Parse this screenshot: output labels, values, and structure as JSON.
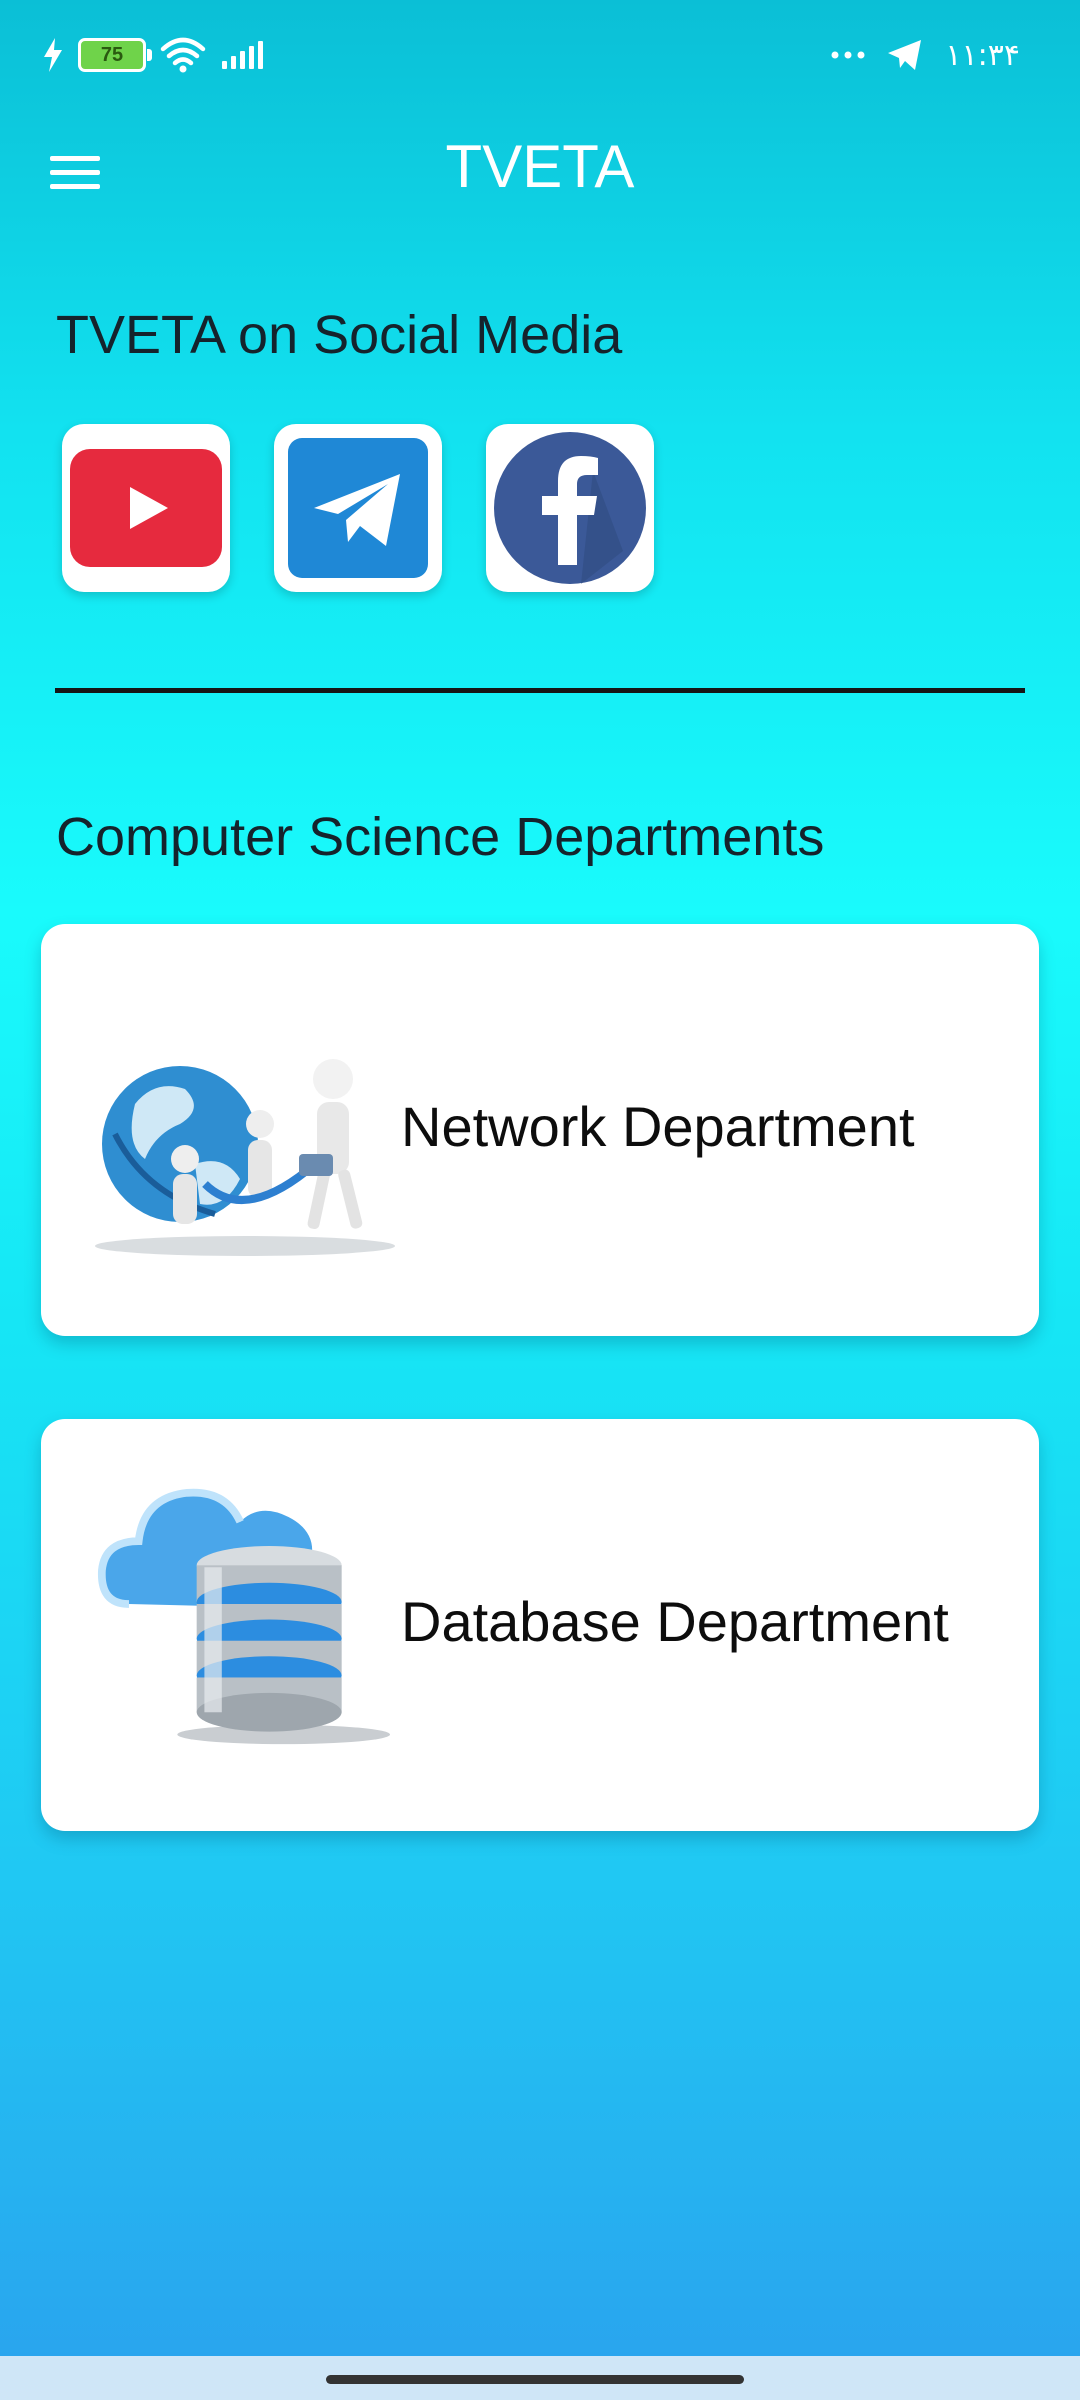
{
  "status_bar": {
    "battery_level": "75",
    "time": "١١:٣۴",
    "icons": [
      "charging-bolt-icon",
      "battery-icon",
      "wifi-icon",
      "signal-bars-icon",
      "more-dots-icon",
      "telegram-notification-icon"
    ]
  },
  "app_bar": {
    "title": "TVETA",
    "menu_icon": "hamburger-menu-icon"
  },
  "social": {
    "heading": "TVETA on Social Media",
    "items": [
      {
        "name": "youtube",
        "icon": "youtube-icon",
        "color": "#e62a3e"
      },
      {
        "name": "telegram",
        "icon": "telegram-icon",
        "color": "#1f88d6"
      },
      {
        "name": "facebook",
        "icon": "facebook-icon",
        "color": "#3b5998"
      }
    ]
  },
  "departments": {
    "heading": "Computer Science Departments",
    "items": [
      {
        "label": "Network Department",
        "icon": "network-globe-illustration"
      },
      {
        "label": "Database Department",
        "icon": "cloud-database-illustration"
      }
    ]
  },
  "colors": {
    "background_top": "#0bbfd6",
    "background_mid": "#19fbfc",
    "background_bottom": "#2aa2ee",
    "heading_text": "#15232c",
    "card": "#ffffff"
  }
}
